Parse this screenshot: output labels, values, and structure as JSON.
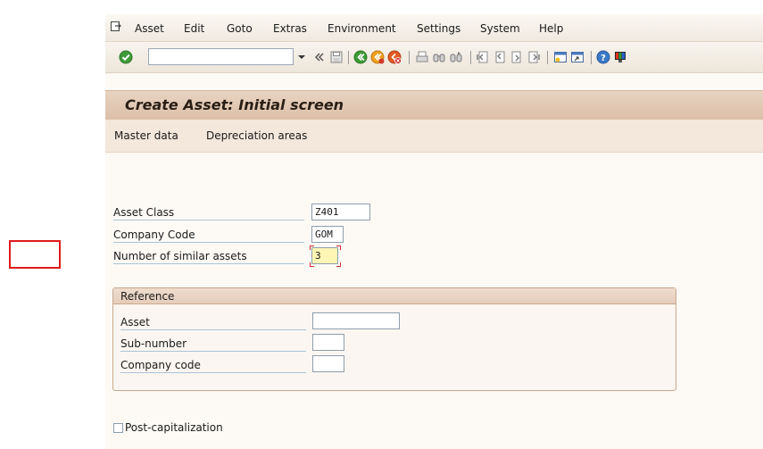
{
  "menu": {
    "items": [
      "Asset",
      "Edit",
      "Goto",
      "Extras",
      "Environment",
      "Settings",
      "System",
      "Help"
    ]
  },
  "toolbar": {
    "command_field_value": "",
    "icons": [
      "enter-check-icon",
      "back-icon",
      "save-icon",
      "back-green-icon",
      "exit-icon",
      "cancel-icon",
      "print-icon",
      "find-icon",
      "find-next-icon",
      "first-page-icon",
      "previous-page-icon",
      "next-page-icon",
      "last-page-icon",
      "create-session-icon",
      "shortcut-icon",
      "help-icon",
      "layout-menu-icon"
    ]
  },
  "title": "Create Asset:  Initial screen",
  "app_toolbar": {
    "master_data": "Master data",
    "depreciation_areas": "Depreciation areas"
  },
  "form": {
    "asset_class": {
      "label": "Asset Class",
      "value": "Z401"
    },
    "company_code": {
      "label": "Company Code",
      "value": "GOM"
    },
    "similar_assets": {
      "label": "Number of similar assets",
      "value": "3"
    }
  },
  "reference": {
    "title": "Reference",
    "asset": {
      "label": "Asset",
      "value": ""
    },
    "sub_number": {
      "label": "Sub-number",
      "value": ""
    },
    "company_code": {
      "label": "Company code",
      "value": ""
    }
  },
  "post_capitalization": {
    "label": "Post-capitalization",
    "checked": false
  },
  "colors": {
    "title_bar": "#dcbfa8",
    "required_field": "#fdf6b4",
    "highlight_box": "#e01b1b"
  }
}
